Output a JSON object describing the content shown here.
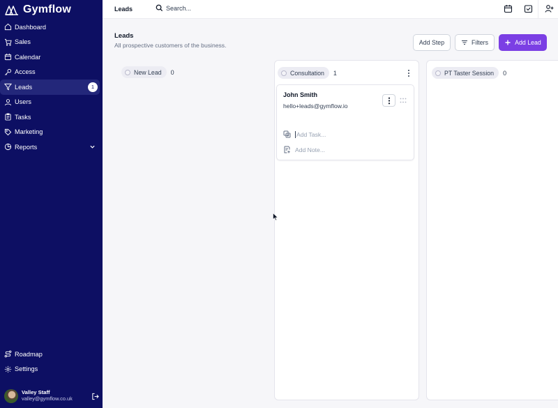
{
  "app": {
    "name": "Gymflow"
  },
  "sidebar": {
    "items": [
      {
        "label": "Dashboard",
        "icon": "home-icon"
      },
      {
        "label": "Sales",
        "icon": "cart-icon"
      },
      {
        "label": "Calendar",
        "icon": "calendar-icon"
      },
      {
        "label": "Access",
        "icon": "key-icon"
      },
      {
        "label": "Leads",
        "icon": "funnel-icon",
        "badge": "1",
        "active": true
      },
      {
        "label": "Users",
        "icon": "user-icon"
      },
      {
        "label": "Tasks",
        "icon": "clipboard-icon"
      },
      {
        "label": "Marketing",
        "icon": "tag-icon"
      },
      {
        "label": "Reports",
        "icon": "pie-chart-icon",
        "expandable": true
      }
    ],
    "bottom_items": [
      {
        "label": "Roadmap",
        "icon": "roadmap-icon"
      },
      {
        "label": "Settings",
        "icon": "gear-icon"
      }
    ],
    "user": {
      "name": "Valley Staff",
      "email": "valley@gymflow.co.uk"
    }
  },
  "topbar": {
    "title": "Leads",
    "search_placeholder": "Search..."
  },
  "page": {
    "title": "Leads",
    "subtitle": "All prospective customers of the business.",
    "buttons": {
      "add_step": "Add Step",
      "filters": "Filters",
      "add_lead": "Add Lead"
    }
  },
  "board": {
    "columns": [
      {
        "name": "New Lead",
        "count": "0"
      },
      {
        "name": "Consultation",
        "count": "1"
      },
      {
        "name": "PT Taster Session",
        "count": "0"
      }
    ],
    "card": {
      "name": "John Smith",
      "email": "hello+leads@gymflow.io",
      "add_task_placeholder": "Add Task...",
      "add_note_placeholder": "Add Note..."
    }
  },
  "colors": {
    "sidebar_bg": "#0d0f63",
    "primary": "#7b3fe4",
    "board_bg": "#f6f6f9"
  }
}
